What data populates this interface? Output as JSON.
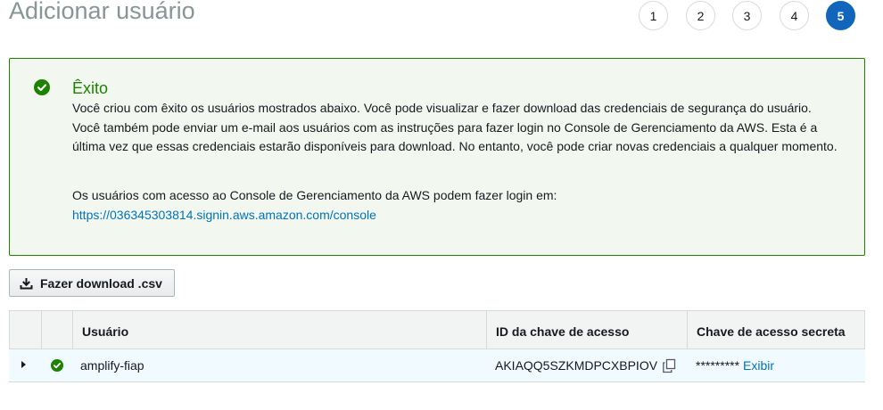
{
  "page": {
    "title": "Adicionar usuário"
  },
  "steps": [
    "1",
    "2",
    "3",
    "4",
    "5"
  ],
  "active_step": "5",
  "alert": {
    "title": "Êxito",
    "body": "Você criou com êxito os usuários mostrados abaixo. Você pode visualizar e fazer download das credenciais de segurança do usuário. Você também pode enviar um e-mail aos usuários com as instruções para fazer login no Console de Gerenciamento da AWS. Esta é a última vez que essas credenciais estarão disponíveis para download. No entanto, você pode criar novas credenciais a qualquer momento.",
    "login_text": "Os usuários com acesso ao Console de Gerenciamento da AWS podem fazer login em:",
    "login_url": "https://036345303814.signin.aws.amazon.com/console"
  },
  "download": {
    "label": "Fazer download .csv"
  },
  "table": {
    "headers": {
      "user": "Usuário",
      "access_key_id": "ID da chave de acesso",
      "secret_key": "Chave de acesso secreta"
    },
    "rows": [
      {
        "user": "amplify-fiap",
        "access_key_id": "AKIAQQ5SZKMDPCXBPIOV",
        "secret_key_masked": "*********",
        "show_label": "Exibir"
      }
    ]
  },
  "colors": {
    "success": "#1d8102",
    "link": "#0073bb",
    "active_step": "#1166bb"
  },
  "icons": {
    "success": "check-circle-icon",
    "download": "download-icon",
    "copy": "copy-icon",
    "expand": "caret-right-icon"
  }
}
